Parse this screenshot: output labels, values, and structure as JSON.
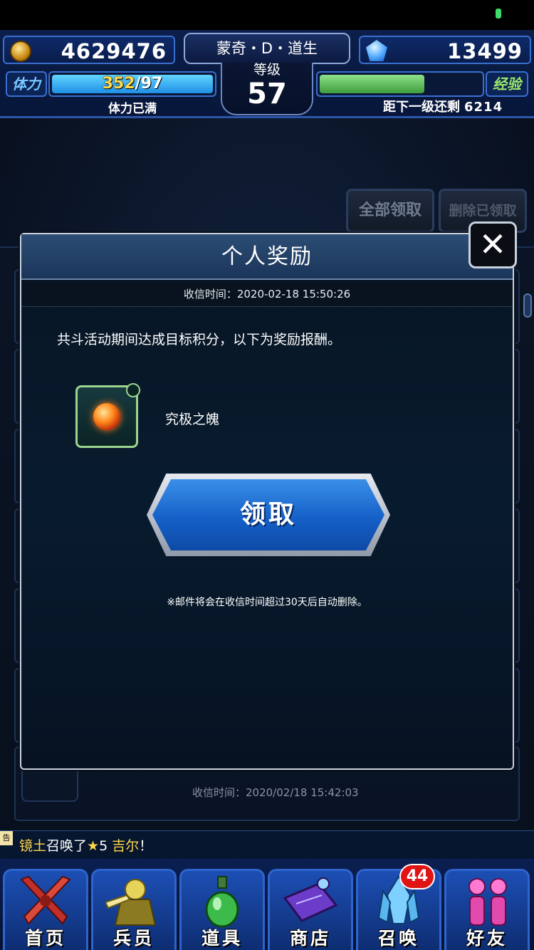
{
  "hud": {
    "gil": "4629476",
    "gems": "13499",
    "player_name": "蒙奇・D・道生",
    "level_label": "等级",
    "level": "57",
    "stamina_label": "体力",
    "stamina_current": "352",
    "stamina_max": "/97",
    "stamina_status": "体力已满",
    "exp_label": "经验",
    "exp_fill_fraction": 0.65,
    "exp_remaining_label": "距下一级还剩",
    "exp_remaining": "6214"
  },
  "mailbox": {
    "claim_all_label": "全部领取",
    "delete_claimed_label": "删除已领取",
    "list_timestamp": "收信时间：2020/02/18 15:42:03"
  },
  "modal": {
    "title": "个人奖励",
    "received_time": "收信时间：2020-02-18 15:50:26",
    "body": "共斗活动期间达成目标积分，以下为奖励报酬。",
    "reward_name": "究极之魄",
    "claim_label": "领取",
    "note": "※邮件将会在收信时间超过30天后自动删除。",
    "close_icon": "close-icon"
  },
  "ticker": {
    "tag": "告",
    "player": "镜土",
    "verb": "召唤了",
    "star": "★",
    "rarity": "5",
    "unit": " 吉尔",
    "end": "！"
  },
  "nav": {
    "items": [
      {
        "label": "首页",
        "icon": "sword-icon"
      },
      {
        "label": "兵员",
        "icon": "unit-icon"
      },
      {
        "label": "道具",
        "icon": "potion-icon"
      },
      {
        "label": "商店",
        "icon": "shop-icon"
      },
      {
        "label": "召唤",
        "icon": "crystal-icon",
        "badge": "44"
      },
      {
        "label": "好友",
        "icon": "friends-icon"
      }
    ]
  },
  "colors": {
    "accent_blue": "#2e64cc",
    "claim_button": "#1560c8",
    "stamina_fill": "#1f8fe6",
    "exp_fill": "#3f9e3d",
    "gold_text": "#ffd84a",
    "badge_red": "#e01414"
  }
}
